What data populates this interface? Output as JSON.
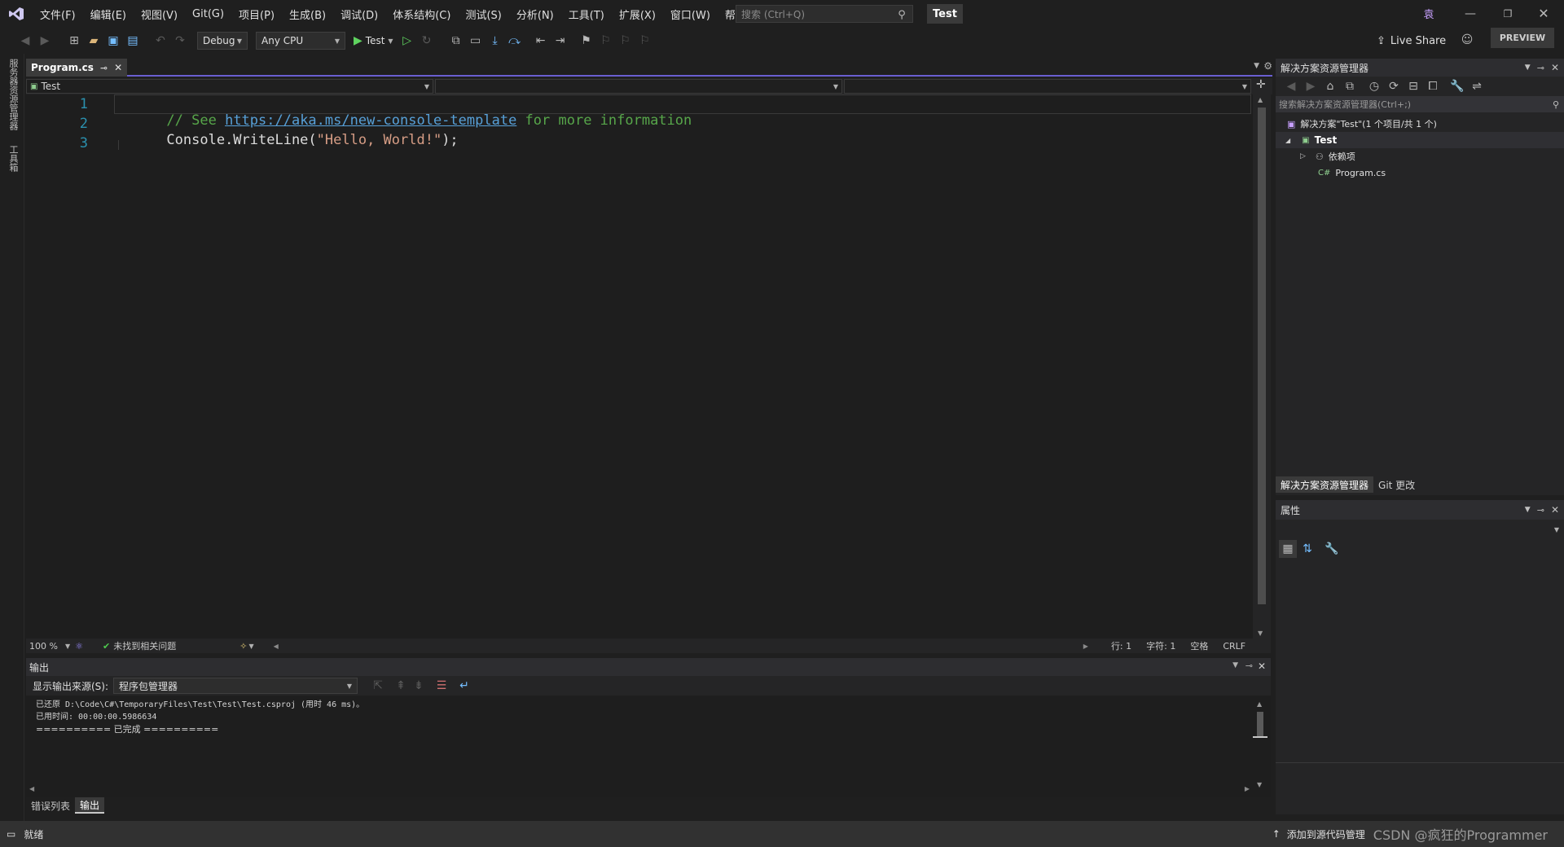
{
  "menu": [
    "文件(F)",
    "编辑(E)",
    "视图(V)",
    "Git(G)",
    "项目(P)",
    "生成(B)",
    "调试(D)",
    "体系结构(C)",
    "测试(S)",
    "分析(N)",
    "工具(T)",
    "扩展(X)",
    "窗口(W)",
    "帮助(H)"
  ],
  "search": {
    "placeholder": "搜索 (Ctrl+Q)"
  },
  "solution_name": "Test",
  "account_initial": "袁",
  "live_share": "Live Share",
  "preview": "PREVIEW",
  "toolbar": {
    "config": "Debug",
    "platform": "Any CPU",
    "run_label": "Test"
  },
  "left_strip": [
    "服务器资源管理器",
    "工具箱"
  ],
  "editor": {
    "tab_name": "Program.cs",
    "nav_project": "Test",
    "lines": [
      {
        "num": "1",
        "comment_prefix": "// See ",
        "link": "https://aka.ms/new-console-template",
        "comment_suffix": " for more information"
      },
      {
        "num": "2",
        "text": "Console.WriteLine(",
        "string": "\"Hello, World!\"",
        "end": ");"
      },
      {
        "num": "3"
      }
    ],
    "zoom": "100 %",
    "issues": "未找到相关问题",
    "line_info": "行: 1",
    "char_info": "字符: 1",
    "whitespace": "空格",
    "eol": "CRLF"
  },
  "output": {
    "title": "输出",
    "source_label": "显示输出来源(S):",
    "source_value": "程序包管理器",
    "lines": [
      "已还原 D:\\Code\\C#\\TemporaryFiles\\Test\\Test\\Test.csproj (用时 46 ms)。",
      "已用时间: 00:00:00.5986634"
    ],
    "done": "========== 已完成 =========="
  },
  "bottom_tabs": [
    "错误列表",
    "输出"
  ],
  "solution_explorer": {
    "title": "解决方案资源管理器",
    "search_placeholder": "搜索解决方案资源管理器(Ctrl+;)",
    "solution_node": "解决方案\"Test\"(1 个项目/共 1 个)",
    "project": "Test",
    "deps": "依赖项",
    "file": "Program.cs",
    "tabs": [
      "解决方案资源管理器",
      "Git 更改"
    ]
  },
  "properties": {
    "title": "属性"
  },
  "statusbar": {
    "ready": "就绪",
    "add_source": "添加到源代码管理",
    "watermark": "CSDN @疯狂的Programmer"
  }
}
